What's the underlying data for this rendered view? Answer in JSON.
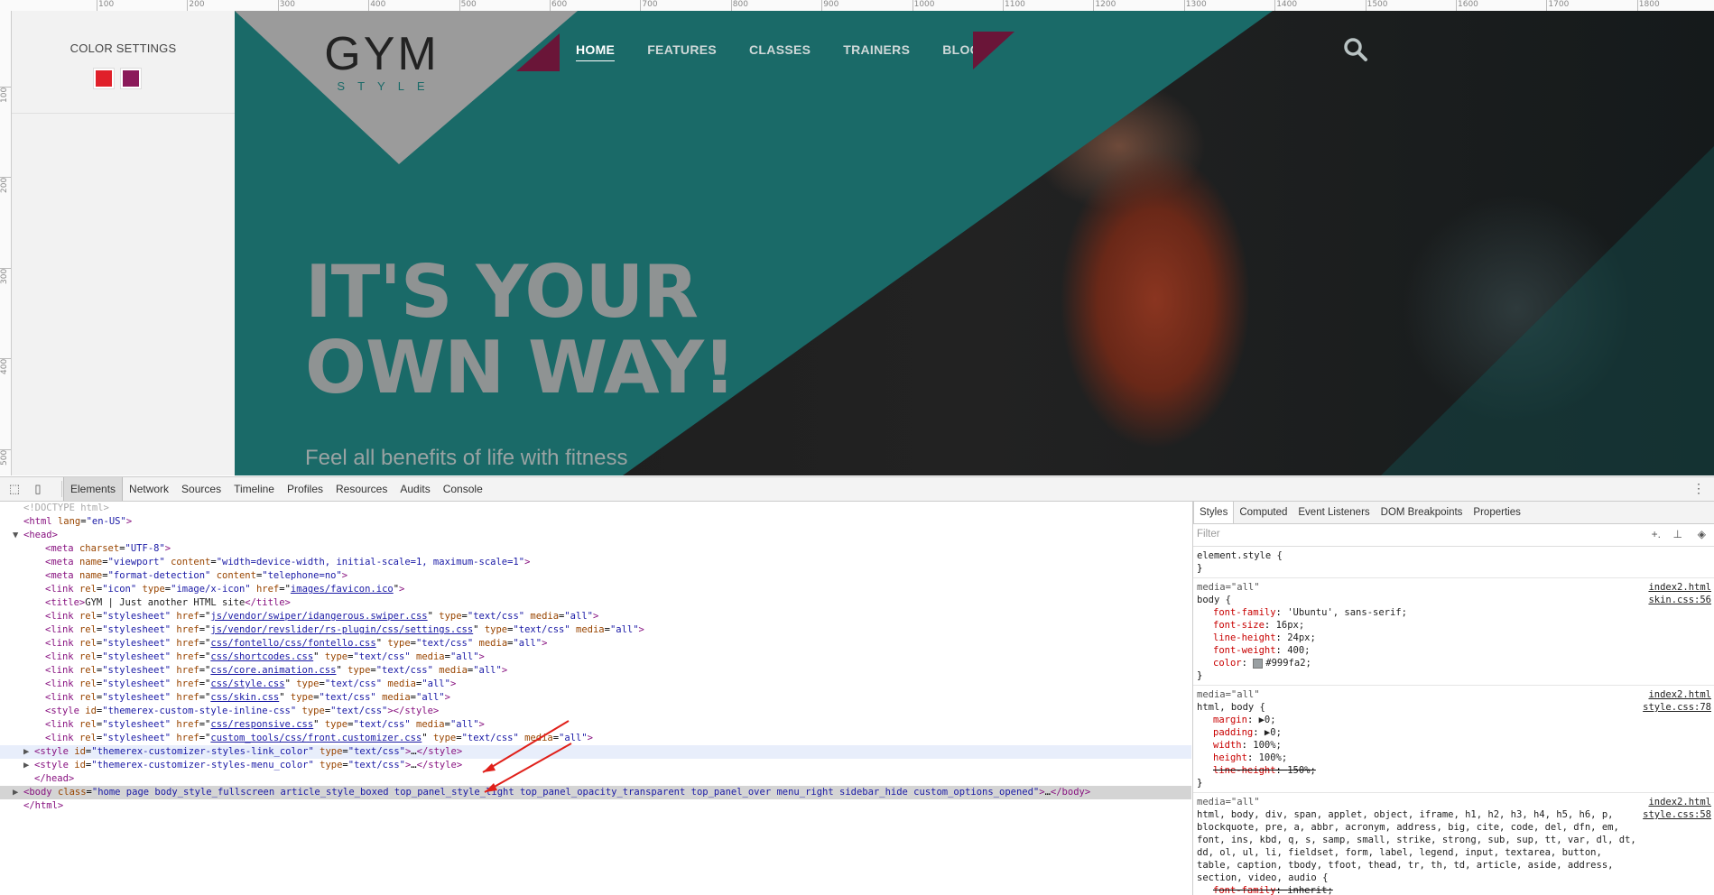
{
  "ruler": {
    "top_labels": [
      "100",
      "200",
      "300",
      "400",
      "500",
      "600",
      "700",
      "800",
      "900",
      "1000",
      "1100",
      "1200",
      "1300",
      "1400",
      "1500",
      "1600",
      "1700",
      "1800"
    ],
    "left_labels": [
      "100",
      "200",
      "300",
      "400",
      "500"
    ]
  },
  "color_panel": {
    "title": "COLOR SETTINGS",
    "swatches": [
      "#e0202a",
      "#8b1a5a"
    ]
  },
  "site": {
    "logo_big": "GYM",
    "logo_small": "STYLE",
    "nav": [
      {
        "label": "HOME",
        "active": true
      },
      {
        "label": "FEATURES",
        "active": false
      },
      {
        "label": "CLASSES",
        "active": false
      },
      {
        "label": "TRAINERS",
        "active": false
      },
      {
        "label": "BLOG",
        "active": false
      }
    ],
    "search_icon": "search-icon",
    "headline_line1": "IT'S YOUR",
    "headline_line2": "OWN WAY!",
    "tagline": "Feel all benefits of life with fitness",
    "colors": {
      "teal": "#1a6a68",
      "accent": "#6a1538",
      "logo_bg": "#9b9b9b"
    }
  },
  "devtools": {
    "tabs": [
      "Elements",
      "Network",
      "Sources",
      "Timeline",
      "Profiles",
      "Resources",
      "Audits",
      "Console"
    ],
    "active_tab": "Elements",
    "dom_lines": [
      {
        "indent": 0,
        "tri": "",
        "html": "<span class='cmt'>&lt;!DOCTYPE html&gt;</span>"
      },
      {
        "indent": 0,
        "tri": "",
        "html": "<span class='tag'>&lt;html</span> <span class='an'>lang</span>=<span class='av'>\"en-US\"</span><span class='tag'>&gt;</span>"
      },
      {
        "indent": 0,
        "tri": "▼",
        "html": "<span class='tag'>&lt;head&gt;</span>"
      },
      {
        "indent": 2,
        "tri": "",
        "html": "<span class='tag'>&lt;meta</span> <span class='an'>charset</span>=<span class='av'>\"UTF-8\"</span><span class='tag'>&gt;</span>"
      },
      {
        "indent": 2,
        "tri": "",
        "html": "<span class='tag'>&lt;meta</span> <span class='an'>name</span>=<span class='av'>\"viewport\"</span> <span class='an'>content</span>=<span class='av'>\"width=device-width, initial-scale=1, maximum-scale=1\"</span><span class='tag'>&gt;</span>"
      },
      {
        "indent": 2,
        "tri": "",
        "html": "<span class='tag'>&lt;meta</span> <span class='an'>name</span>=<span class='av'>\"format-detection\"</span> <span class='an'>content</span>=<span class='av'>\"telephone=no\"</span><span class='tag'>&gt;</span>"
      },
      {
        "indent": 2,
        "tri": "",
        "html": "<span class='tag'>&lt;link</span> <span class='an'>rel</span>=<span class='av'>\"icon\"</span> <span class='an'>type</span>=<span class='av'>\"image/x-icon\"</span> <span class='an'>href</span>=\"<span class='lnk'>images/favicon.ico</span>\"<span class='tag'>&gt;</span>"
      },
      {
        "indent": 2,
        "tri": "",
        "html": "<span class='tag'>&lt;title&gt;</span><span class='txt'>GYM | Just another HTML site</span><span class='tag'>&lt;/title&gt;</span>"
      },
      {
        "indent": 2,
        "tri": "",
        "html": "<span class='tag'>&lt;link</span> <span class='an'>rel</span>=<span class='av'>\"stylesheet\"</span> <span class='an'>href</span>=\"<span class='lnk'>js/vendor/swiper/idangerous.swiper.css</span>\" <span class='an'>type</span>=<span class='av'>\"text/css\"</span> <span class='an'>media</span>=<span class='av'>\"all\"</span><span class='tag'>&gt;</span>"
      },
      {
        "indent": 2,
        "tri": "",
        "html": "<span class='tag'>&lt;link</span> <span class='an'>rel</span>=<span class='av'>\"stylesheet\"</span> <span class='an'>href</span>=\"<span class='lnk'>js/vendor/revslider/rs-plugin/css/settings.css</span>\" <span class='an'>type</span>=<span class='av'>\"text/css\"</span> <span class='an'>media</span>=<span class='av'>\"all\"</span><span class='tag'>&gt;</span>"
      },
      {
        "indent": 2,
        "tri": "",
        "html": "<span class='tag'>&lt;link</span> <span class='an'>rel</span>=<span class='av'>\"stylesheet\"</span> <span class='an'>href</span>=\"<span class='lnk'>css/fontello/css/fontello.css</span>\" <span class='an'>type</span>=<span class='av'>\"text/css\"</span> <span class='an'>media</span>=<span class='av'>\"all\"</span><span class='tag'>&gt;</span>"
      },
      {
        "indent": 2,
        "tri": "",
        "html": "<span class='tag'>&lt;link</span> <span class='an'>rel</span>=<span class='av'>\"stylesheet\"</span> <span class='an'>href</span>=\"<span class='lnk'>css/shortcodes.css</span>\" <span class='an'>type</span>=<span class='av'>\"text/css\"</span> <span class='an'>media</span>=<span class='av'>\"all\"</span><span class='tag'>&gt;</span>"
      },
      {
        "indent": 2,
        "tri": "",
        "html": "<span class='tag'>&lt;link</span> <span class='an'>rel</span>=<span class='av'>\"stylesheet\"</span> <span class='an'>href</span>=\"<span class='lnk'>css/core.animation.css</span>\" <span class='an'>type</span>=<span class='av'>\"text/css\"</span> <span class='an'>media</span>=<span class='av'>\"all\"</span><span class='tag'>&gt;</span>"
      },
      {
        "indent": 2,
        "tri": "",
        "html": "<span class='tag'>&lt;link</span> <span class='an'>rel</span>=<span class='av'>\"stylesheet\"</span> <span class='an'>href</span>=\"<span class='lnk'>css/style.css</span>\" <span class='an'>type</span>=<span class='av'>\"text/css\"</span> <span class='an'>media</span>=<span class='av'>\"all\"</span><span class='tag'>&gt;</span>"
      },
      {
        "indent": 2,
        "tri": "",
        "html": "<span class='tag'>&lt;link</span> <span class='an'>rel</span>=<span class='av'>\"stylesheet\"</span> <span class='an'>href</span>=\"<span class='lnk'>css/skin.css</span>\" <span class='an'>type</span>=<span class='av'>\"text/css\"</span> <span class='an'>media</span>=<span class='av'>\"all\"</span><span class='tag'>&gt;</span>"
      },
      {
        "indent": 2,
        "tri": "",
        "html": "<span class='tag'>&lt;style</span> <span class='an'>id</span>=<span class='av'>\"themerex-custom-style-inline-css\"</span> <span class='an'>type</span>=<span class='av'>\"text/css\"</span><span class='tag'>&gt;&lt;/style&gt;</span>"
      },
      {
        "indent": 2,
        "tri": "",
        "html": "<span class='tag'>&lt;link</span> <span class='an'>rel</span>=<span class='av'>\"stylesheet\"</span> <span class='an'>href</span>=\"<span class='lnk'>css/responsive.css</span>\" <span class='an'>type</span>=<span class='av'>\"text/css\"</span> <span class='an'>media</span>=<span class='av'>\"all\"</span><span class='tag'>&gt;</span>"
      },
      {
        "indent": 2,
        "tri": "",
        "html": "<span class='tag'>&lt;link</span> <span class='an'>rel</span>=<span class='av'>\"stylesheet\"</span> <span class='an'>href</span>=\"<span class='lnk'>custom_tools/css/front.customizer.css</span>\" <span class='an'>type</span>=<span class='av'>\"text/css\"</span> <span class='an'>media</span>=<span class='av'>\"all\"</span><span class='tag'>&gt;</span>"
      },
      {
        "indent": 1,
        "tri": "▶",
        "hl": true,
        "html": "<span class='tag'>&lt;style</span> <span class='an'>id</span>=<span class='av'>\"themerex-customizer-styles-link_color\"</span> <span class='an'>type</span>=<span class='av'>\"text/css\"</span><span class='tag'>&gt;</span>…<span class='tag'>&lt;/style&gt;</span>"
      },
      {
        "indent": 1,
        "tri": "▶",
        "html": "<span class='tag'>&lt;style</span> <span class='an'>id</span>=<span class='av'>\"themerex-customizer-styles-menu_color\"</span> <span class='an'>type</span>=<span class='av'>\"text/css\"</span><span class='tag'>&gt;</span>…<span class='tag'>&lt;/style&gt;</span>"
      },
      {
        "indent": 1,
        "tri": "",
        "html": "<span class='tag'>&lt;/head&gt;</span>"
      },
      {
        "indent": 0,
        "tri": "▶",
        "sel": true,
        "html": "<span class='tag'>&lt;body</span> <span class='an'>class</span>=<span class='av'>\"home page body_style_fullscreen article_style_boxed top_panel_style_light top_panel_opacity_transparent top_panel_over menu_right sidebar_hide custom_options_opened\"</span><span class='tag'>&gt;</span>…<span class='tag'>&lt;/body&gt;</span>"
      },
      {
        "indent": 0,
        "tri": "",
        "html": "<span class='tag'>&lt;/html&gt;</span>"
      }
    ],
    "side_tabs": [
      "Styles",
      "Computed",
      "Event Listeners",
      "DOM Breakpoints",
      "Properties"
    ],
    "active_side_tab": "Styles",
    "filter_placeholder": "Filter",
    "rules": [
      {
        "media": "",
        "src": "",
        "src2": "",
        "selector": "element.style {",
        "props": []
      },
      {
        "media": "media=\"all\"",
        "src": "index2.html",
        "src2": "skin.css:56",
        "selector": "body {",
        "props": [
          {
            "n": "font-family",
            "v": "'Ubuntu', sans-serif;"
          },
          {
            "n": "font-size",
            "v": "16px;"
          },
          {
            "n": "line-height",
            "v": "24px;"
          },
          {
            "n": "font-weight",
            "v": "400;"
          },
          {
            "n": "color",
            "v": "#999fa2;",
            "swatch": true
          }
        ]
      },
      {
        "media": "media=\"all\"",
        "src": "index2.html",
        "src2": "style.css:78",
        "selector": "html, body {",
        "props": [
          {
            "n": "margin",
            "v": "▶0;"
          },
          {
            "n": "padding",
            "v": "▶0;"
          },
          {
            "n": "width",
            "v": "100%;"
          },
          {
            "n": "height",
            "v": "100%;"
          },
          {
            "n": "line-height",
            "v": "150%;",
            "strike": true
          }
        ]
      },
      {
        "media": "media=\"all\"",
        "src": "index2.html",
        "src2": "style.css:58",
        "selector": "html, body, div, span, applet, object, iframe, h1, h2, h3, h4, h5, h6, p, blockquote, pre, a, abbr, acronym, address, big, cite, code, del, dfn, em, font, ins, kbd, q, s, samp, small, strike, strong, sub, sup, tt, var, dl, dt, dd, ol, ul, li, fieldset, form, label, legend, input, textarea, button, table, caption, tbody, tfoot, thead, tr, th, td, article, aside, address, section, video, audio {",
        "props": [
          {
            "n": "font-family",
            "v": "inherit;",
            "strike": true
          }
        ]
      }
    ]
  }
}
